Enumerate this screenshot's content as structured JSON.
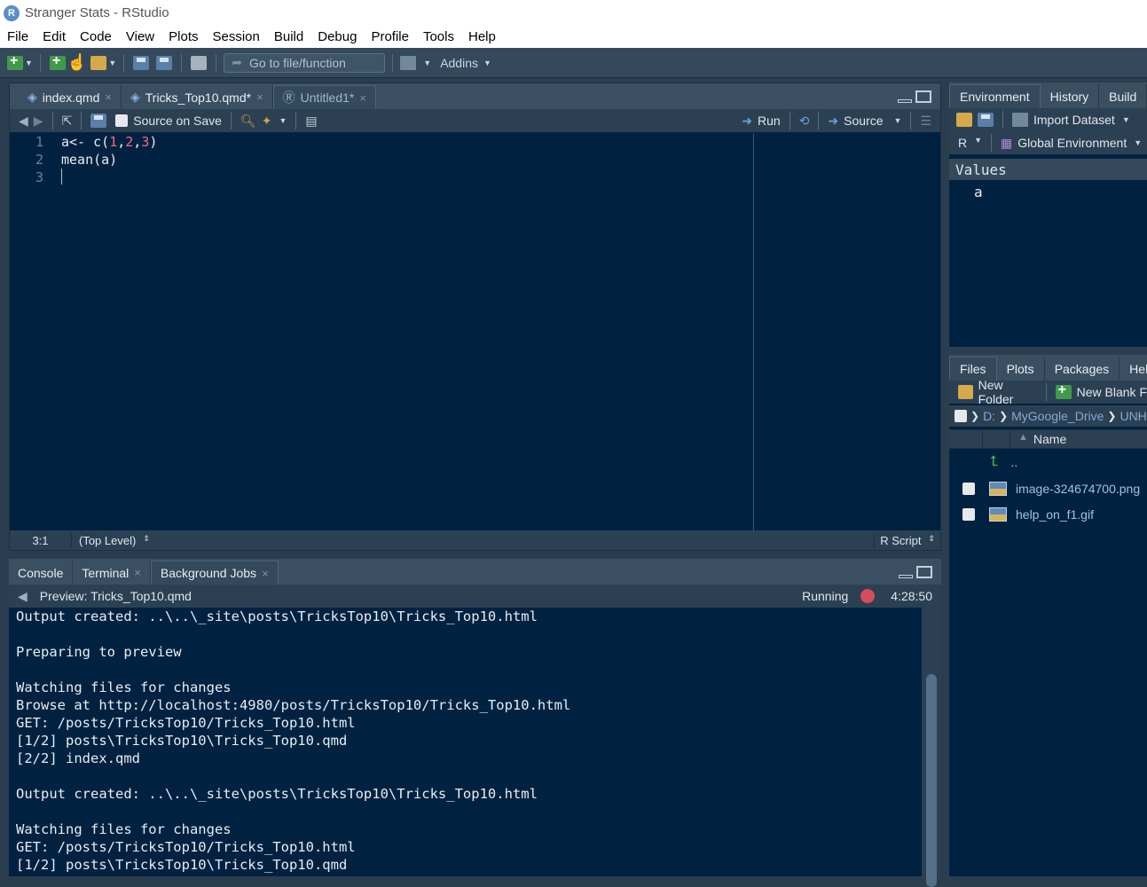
{
  "window": {
    "title": "Stranger Stats - RStudio",
    "logo": "R"
  },
  "menu": [
    "File",
    "Edit",
    "Code",
    "View",
    "Plots",
    "Session",
    "Build",
    "Debug",
    "Profile",
    "Tools",
    "Help"
  ],
  "toolbar": {
    "goto_placeholder": "Go to file/function",
    "addins_label": "Addins"
  },
  "editor": {
    "tabs": [
      {
        "label": "index.qmd",
        "close": "×"
      },
      {
        "label": "Tricks_Top10.qmd*",
        "close": "×"
      },
      {
        "label": "Untitled1*",
        "close": "×"
      }
    ],
    "source_on_save_label": "Source on Save",
    "run_label": "Run",
    "source_label": "Source",
    "line_numbers": [
      "1",
      "2",
      "3"
    ],
    "code": [
      {
        "pre": "a<- c(",
        "n1": "1",
        "s1": ",",
        "n2": "2",
        "s2": ",",
        "n3": "3",
        "post": ")"
      },
      {
        "text": "mean(a)"
      },
      {
        "text": ""
      }
    ],
    "status": {
      "position": "3:1",
      "scope": "(Top Level)",
      "file_type": "R Script"
    }
  },
  "console": {
    "tabs": [
      {
        "label": "Console"
      },
      {
        "label": "Terminal",
        "close": "×"
      },
      {
        "label": "Background Jobs",
        "close": "×"
      }
    ],
    "job_title": "Preview: Tricks_Top10.qmd",
    "job_status": "Running",
    "job_time": "4:28:50",
    "lines": [
      "Output created: ..\\..\\_site\\posts\\TricksTop10\\Tricks_Top10.html",
      "",
      "Preparing to preview",
      "",
      "Watching files for changes",
      "Browse at http://localhost:4980/posts/TricksTop10/Tricks_Top10.html",
      "GET: /posts/TricksTop10/Tricks_Top10.html",
      "[1/2] posts\\TricksTop10\\Tricks_Top10.qmd",
      "[2/2] index.qmd",
      "",
      "Output created: ..\\..\\_site\\posts\\TricksTop10\\Tricks_Top10.html",
      "",
      "Watching files for changes",
      "GET: /posts/TricksTop10/Tricks_Top10.html",
      "[1/2] posts\\TricksTop10\\Tricks_Top10.qmd"
    ]
  },
  "environment": {
    "tabs": [
      "Environment",
      "History",
      "Build"
    ],
    "import_label": "Import Dataset",
    "lang": "R",
    "scope": "Global Environment",
    "section": "Values",
    "values": [
      "a"
    ]
  },
  "files": {
    "tabs": [
      "Files",
      "Plots",
      "Packages",
      "Help"
    ],
    "new_folder_label": "New Folder",
    "new_blank_label": "New Blank F",
    "path": {
      "drive": "D:",
      "folder": "MyGoogle_Drive",
      "next": "UNH"
    },
    "name_header": "Name",
    "parent": "..",
    "items": [
      "image-324674700.png",
      "help_on_f1.gif"
    ]
  }
}
